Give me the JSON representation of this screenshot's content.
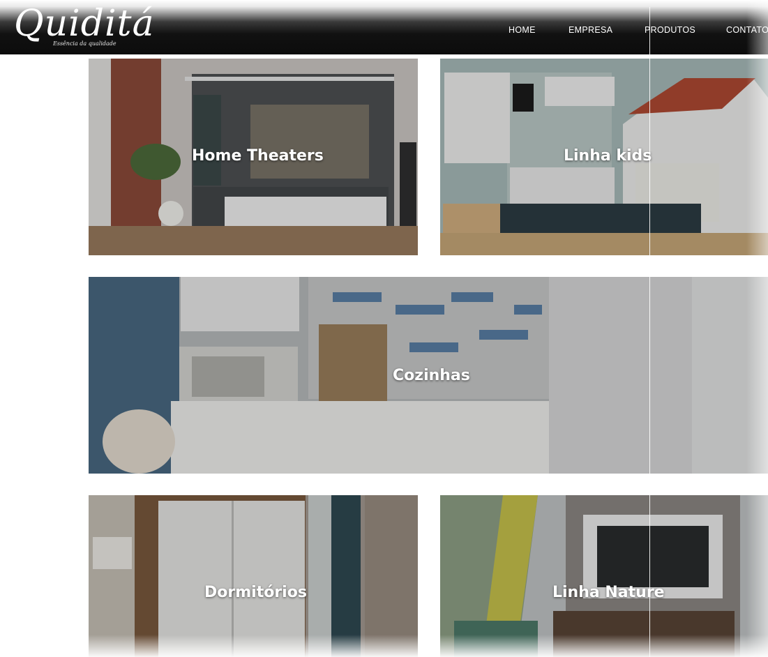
{
  "brand": {
    "logo_text": "Quiditá",
    "tagline": "Essência da qualidade"
  },
  "nav": {
    "items": [
      {
        "label": "HOME"
      },
      {
        "label": "EMPRESA"
      },
      {
        "label": "PRODUTOS"
      },
      {
        "label": "CONTATO"
      }
    ]
  },
  "categories": [
    {
      "label": "Home Theaters"
    },
    {
      "label": "Linha kids"
    },
    {
      "label": "Cozinhas"
    },
    {
      "label": "Dormitórios"
    },
    {
      "label": "Linha Nature"
    }
  ],
  "colors": {
    "header_bg": "#111111",
    "nav_text": "#ffffff",
    "label_text": "#ffffff"
  }
}
